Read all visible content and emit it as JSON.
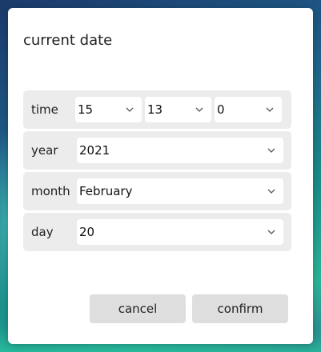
{
  "dialog": {
    "title": "current date"
  },
  "time": {
    "label": "time",
    "hour": "15",
    "minute": "13",
    "second": "0"
  },
  "year": {
    "label": "year",
    "value": "2021"
  },
  "month": {
    "label": "month",
    "value": "February"
  },
  "day": {
    "label": "day",
    "value": "20"
  },
  "buttons": {
    "cancel": "cancel",
    "confirm": "confirm"
  },
  "icons": {
    "dropdown": "chevron-down-icon"
  }
}
